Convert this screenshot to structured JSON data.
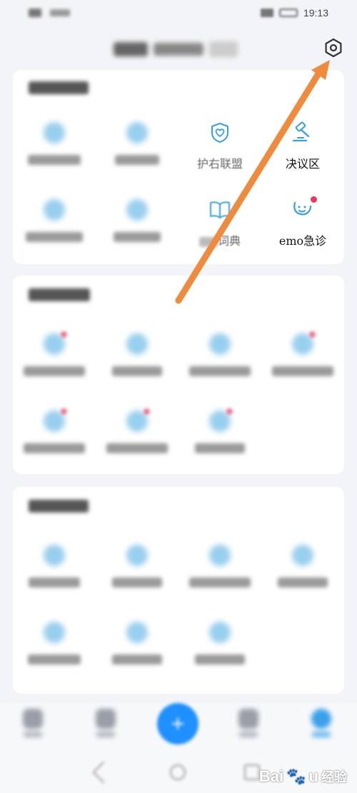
{
  "status_bar": {
    "carrier": "",
    "time": "19:13"
  },
  "header": {
    "title": "",
    "settings_icon": "settings-hexagon-icon"
  },
  "sections": [
    {
      "title": "",
      "items": [
        {
          "label": "",
          "icon": "blurred-icon"
        },
        {
          "label": "",
          "icon": "blurred-icon"
        },
        {
          "label": "护右联盟",
          "icon": "heart-shield-icon"
        },
        {
          "label": "决议区",
          "icon": "gavel-icon"
        },
        {
          "label": "",
          "icon": "blurred-icon"
        },
        {
          "label": "",
          "icon": "blurred-icon"
        },
        {
          "label": "词典",
          "icon": "book-icon"
        },
        {
          "label": "emo急诊",
          "icon": "stethoscope-icon"
        }
      ]
    },
    {
      "title": "",
      "items": [
        {
          "label": "",
          "icon": "blurred-icon"
        },
        {
          "label": "",
          "icon": "blurred-icon"
        },
        {
          "label": "",
          "icon": "blurred-icon"
        },
        {
          "label": "",
          "icon": "blurred-icon"
        },
        {
          "label": "",
          "icon": "blurred-icon"
        },
        {
          "label": "",
          "icon": "blurred-icon"
        },
        {
          "label": "",
          "icon": "blurred-icon"
        }
      ]
    },
    {
      "title": "",
      "items": [
        {
          "label": "",
          "icon": "blurred-icon"
        },
        {
          "label": "",
          "icon": "blurred-icon"
        },
        {
          "label": "",
          "icon": "blurred-icon"
        },
        {
          "label": "",
          "icon": "blurred-icon"
        },
        {
          "label": "",
          "icon": "blurred-icon"
        },
        {
          "label": "",
          "icon": "blurred-icon"
        },
        {
          "label": "",
          "icon": "blurred-icon"
        }
      ]
    }
  ],
  "tabbar": {
    "fab_symbol": "+"
  },
  "watermark": {
    "brand": "Bai",
    "brand_end": "u",
    "sub": "经验"
  },
  "colors": {
    "accent": "#1e90ff",
    "icon_blue": "#3aa0d8",
    "badge": "#e8395a",
    "arrow": "#f08a3c"
  }
}
